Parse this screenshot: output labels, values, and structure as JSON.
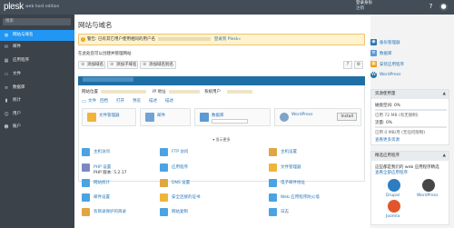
{
  "header": {
    "logo": "plesk",
    "edition": "web host edition",
    "user_line1": "登录身份",
    "user_line2": "注销",
    "icons": [
      "help-icon",
      "profile-icon"
    ]
  },
  "sidebar": {
    "search_placeholder": "搜索",
    "items": [
      {
        "label": "网站与域名",
        "icon": "globe-icon",
        "active": true
      },
      {
        "label": "邮件",
        "icon": "mail-icon"
      },
      {
        "label": "应用程序",
        "icon": "apps-icon"
      },
      {
        "label": "文件",
        "icon": "folder-icon"
      },
      {
        "label": "数据库",
        "icon": "database-icon"
      },
      {
        "label": "统计",
        "icon": "stats-icon"
      },
      {
        "label": "用户",
        "icon": "users-icon"
      },
      {
        "label": "账户",
        "icon": "account-icon"
      }
    ]
  },
  "page": {
    "title": "网站与域名",
    "notice_prefix": "警告: 已有其它用户使用相同的用户名",
    "notice_suffix": "登录到 Plesk»",
    "context_text": "在此处您可以创建并管理网站",
    "toolbar": {
      "add_domain": "添加域名",
      "add_subdomain": "添加子域名",
      "add_alias": "添加域名别名"
    }
  },
  "domain": {
    "info": {
      "site_label": "网站位置",
      "ip_label": "IP 地址",
      "sys_user_label": "系统用户"
    },
    "links": [
      "文件",
      "回档",
      "打开",
      "预览",
      "描述",
      "描述"
    ],
    "cards": [
      {
        "label": "文件管理器",
        "color": "#f0b43c"
      },
      {
        "label": "邮件",
        "color": "#6fa3d8"
      },
      {
        "label": "数据库",
        "color": "#5b9bd5"
      },
      {
        "label": "WordPress",
        "color": "#7fa4c6",
        "button": "Install"
      }
    ],
    "more": "显示更多",
    "tools": [
      {
        "label": "主机访问",
        "icon_color": "#4ba3e2"
      },
      {
        "label": "FTP 访问",
        "icon_color": "#4ba3e2"
      },
      {
        "label": "主机设置",
        "icon_color": "#e0a642"
      },
      {
        "label": "PHP 设置",
        "icon_color": "#7d88c2",
        "sub": "PHP 版本: 5.2.17"
      },
      {
        "label": "应用程序",
        "icon_color": "#4ba3e2"
      },
      {
        "label": "文件管理器",
        "icon_color": "#f0b43c"
      },
      {
        "label": "网站统计",
        "icon_color": "#4ba3e2"
      },
      {
        "label": "DNS 设置",
        "icon_color": "#e0a642"
      },
      {
        "label": "电子邮件地址",
        "icon_color": "#4ba3e2"
      },
      {
        "label": "邮件设置",
        "icon_color": "#4ba3e2"
      },
      {
        "label": "安全连接的证书",
        "icon_color": "#f0b43c"
      },
      {
        "label": "Web 应用程序防火墙",
        "icon_color": "#4ba3e2"
      },
      {
        "label": "有目录保护的目录",
        "icon_color": "#e0a642"
      },
      {
        "label": "网站复制",
        "icon_color": "#4ba3e2"
      },
      {
        "label": "日志",
        "icon_color": "#4ba3e2"
      }
    ]
  },
  "right": {
    "links": [
      {
        "label": "备份管理器",
        "color": "#2a75b6"
      },
      {
        "label": "数据库",
        "color": "#5b9bd5"
      },
      {
        "label": "安装应用程序",
        "color": "#e8a11a"
      },
      {
        "label": "WordPress",
        "color": "#21759b"
      }
    ],
    "resources": {
      "title": "资源使用量",
      "disk": "磁盘空间: 0%",
      "disk_used": "已用 72 MB (有无限制)",
      "traffic": "流量: 0%",
      "traffic_used": "已用 0 MB/月 (无任何限制)",
      "more": "查看更多资源"
    },
    "apps": {
      "title": "精选应用程序",
      "desc": "这些都是我们的 web 应用程序精选",
      "see_all": "查看全部应用程序",
      "items": [
        {
          "label": "Drupal",
          "color": "#2d7ec0"
        },
        {
          "label": "WordPress",
          "color": "#464646"
        },
        {
          "label": "Joomla",
          "color": "#e1562c"
        }
      ]
    }
  }
}
